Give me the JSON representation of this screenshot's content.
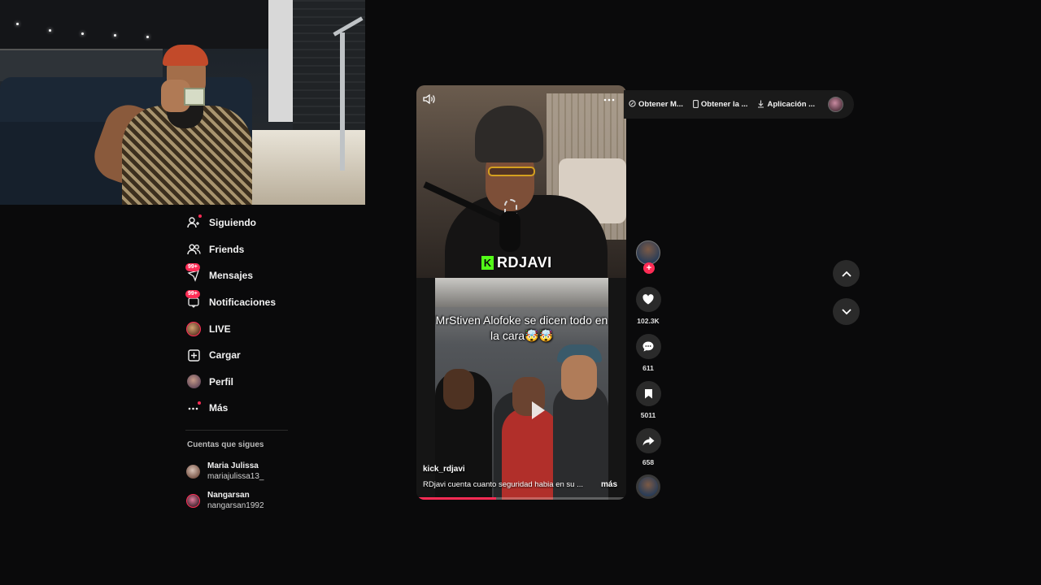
{
  "sidebar": {
    "items": [
      {
        "label": "Siguiendo",
        "icon": "user-following-icon"
      },
      {
        "label": "Friends",
        "icon": "friends-icon"
      },
      {
        "label": "Mensajes",
        "icon": "messages-icon",
        "badge": "99+"
      },
      {
        "label": "Notificaciones",
        "icon": "notifications-icon",
        "badge": "99+"
      },
      {
        "label": "LIVE",
        "icon": "live-avatar-icon"
      },
      {
        "label": "Cargar",
        "icon": "upload-icon"
      },
      {
        "label": "Perfil",
        "icon": "profile-avatar-icon"
      },
      {
        "label": "Más",
        "icon": "more-icon"
      }
    ],
    "following_title": "Cuentas que sigues",
    "following": [
      {
        "name": "Maria Julissa",
        "handle": "mariajulissa13_"
      },
      {
        "name": "Nangarsan",
        "handle": "nangarsan1992"
      }
    ]
  },
  "video": {
    "brand": "RDJAVI",
    "caption_overlay": "MrStiven  Alofoke se dicen todo en la cara🤯🤯",
    "author": "kick_rdjavi",
    "description": "RDjavi cuenta cuanto seguridad habia en su ...",
    "more_label": "más",
    "progress": 0.38
  },
  "top_bar": {
    "buttons": [
      {
        "label": "Obtener M...",
        "icon": "coin-icon"
      },
      {
        "label": "Obtener la ...",
        "icon": "phone-icon"
      },
      {
        "label": "Aplicación ...",
        "icon": "download-icon"
      }
    ]
  },
  "actions": {
    "likes": "102.3K",
    "comments": "611",
    "saves": "5011",
    "shares": "658"
  },
  "colors": {
    "accent": "#fe2c55",
    "background": "#0a0a0b",
    "kick_green": "#53fc18"
  }
}
